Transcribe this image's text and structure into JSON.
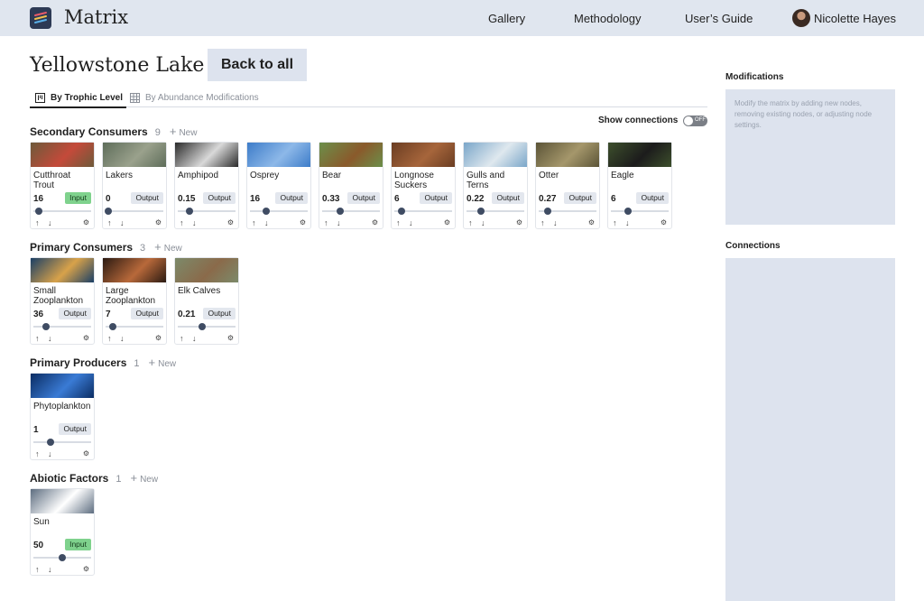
{
  "app": {
    "title": "Matrix"
  },
  "nav": {
    "links": [
      "Gallery",
      "Methodology",
      "User’s Guide"
    ],
    "user": "Nicolette Hayes"
  },
  "header": {
    "title": "Yellowstone Lake",
    "back_label": "Back to all"
  },
  "tabs": [
    "By Trophic Level",
    "By Abundance Modifications"
  ],
  "show_connections": {
    "label": "Show connections",
    "state": "OFF"
  },
  "new_label": "New",
  "sections": [
    {
      "title": "Secondary Consumers",
      "count": "9",
      "nodes": [
        {
          "name": "Cutthroat Trout",
          "value": "16",
          "badge": "Input",
          "level": 0.1
        },
        {
          "name": "Lakers",
          "value": "0",
          "badge": "Output",
          "level": 0.05
        },
        {
          "name": "Amphipod",
          "value": "0.15",
          "badge": "Output",
          "level": 0.2
        },
        {
          "name": "Osprey",
          "value": "16",
          "badge": "Output",
          "level": 0.28
        },
        {
          "name": "Bear",
          "value": "0.33",
          "badge": "Output",
          "level": 0.32
        },
        {
          "name": "Longnose Suckers",
          "value": "6",
          "badge": "Output",
          "level": 0.12
        },
        {
          "name": "Gulls and Terns",
          "value": "0.22",
          "badge": "Output",
          "level": 0.25
        },
        {
          "name": "Otter",
          "value": "0.27",
          "badge": "Output",
          "level": 0.15
        },
        {
          "name": "Eagle",
          "value": "6",
          "badge": "Output",
          "level": 0.3
        }
      ]
    },
    {
      "title": "Primary Consumers",
      "count": "3",
      "nodes": [
        {
          "name": "Small Zooplankton",
          "value": "36",
          "badge": "Output",
          "level": 0.22
        },
        {
          "name": "Large Zooplankton",
          "value": "7",
          "badge": "Output",
          "level": 0.12
        },
        {
          "name": "Elk Calves",
          "value": "0.21",
          "badge": "Output",
          "level": 0.42
        }
      ]
    },
    {
      "title": "Primary Producers",
      "count": "1",
      "nodes": [
        {
          "name": "Phytoplankton",
          "value": "1",
          "badge": "Output",
          "level": 0.3
        }
      ]
    },
    {
      "title": "Abiotic Factors",
      "count": "1",
      "nodes": [
        {
          "name": "Sun",
          "value": "50",
          "badge": "Input",
          "level": 0.5
        }
      ]
    }
  ],
  "thumb_colors": {
    "Cutthroat Trout": [
      "#6d5a3a",
      "#c44a3a"
    ],
    "Lakers": [
      "#5e6d5a",
      "#9aa18c"
    ],
    "Amphipod": [
      "#2a2a2a",
      "#d9d9d9"
    ],
    "Osprey": [
      "#3d7cc9",
      "#8db8e8"
    ],
    "Bear": [
      "#6b8f4a",
      "#8a5a2b"
    ],
    "Longnose Suckers": [
      "#6a3d22",
      "#a6653b"
    ],
    "Gulls and Terns": [
      "#7aa6c9",
      "#dfe8ee"
    ],
    "Otter": [
      "#5b5437",
      "#a5976b"
    ],
    "Eagle": [
      "#3d4f2c",
      "#1c1c1c"
    ],
    "Small Zooplankton": [
      "#1a3f66",
      "#d8a24a"
    ],
    "Large Zooplankton": [
      "#2a1a12",
      "#b8693a"
    ],
    "Elk Calves": [
      "#7c8a6a",
      "#8a6a4a"
    ],
    "Phytoplankton": [
      "#0b2d63",
      "#3a7bd5"
    ],
    "Sun": [
      "#5d6d80",
      "#ffffff"
    ]
  },
  "panels": {
    "modifications": {
      "title": "Modifications",
      "text": "Modify the matrix by adding new nodes, removing existing nodes, or adjusting node settings."
    },
    "connections": {
      "title": "Connections"
    }
  },
  "icons": {
    "up": "↑",
    "down": "↓",
    "gear": "⚙"
  },
  "colors": {
    "nav_bg": "#e0e6ef",
    "panel_bg": "#dde3ee",
    "input_badge": "#7fd28d"
  }
}
